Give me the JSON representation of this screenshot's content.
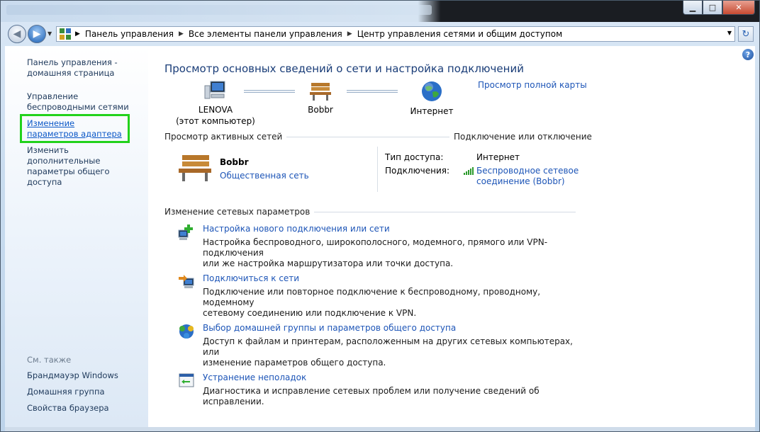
{
  "titlebar": {
    "minimize": "▁",
    "maximize": "□",
    "close": "✕"
  },
  "address": {
    "crumbs": [
      "Панель управления",
      "Все элементы панели управления",
      "Центр управления сетями и общим доступом"
    ]
  },
  "sidebar": {
    "home": "Панель управления - домашняя страница",
    "wireless": "Управление беспроводными сетями",
    "adapter": "Изменение параметров адаптера",
    "sharing": "Изменить дополнительные параметры общего доступа",
    "see_also": "См. также",
    "firewall": "Брандмауэр Windows",
    "homegroup": "Домашняя группа",
    "browser": "Свойства браузера"
  },
  "main": {
    "title": "Просмотр основных сведений о сети и настройка подключений",
    "full_map": "Просмотр полной карты",
    "map": {
      "computer_name": "LENOVA",
      "computer_sub": "(этот компьютер)",
      "network": "Bobbr",
      "internet": "Интернет"
    },
    "active_networks": {
      "title": "Просмотр активных сетей",
      "connect_link": "Подключение или отключение",
      "network_name": "Bobbr",
      "network_type": "Общественная сеть",
      "access_label": "Тип доступа:",
      "access_value": "Интернет",
      "connections_label": "Подключения:",
      "connection_line1": "Беспроводное сетевое",
      "connection_line2": "соединение (Bobbr)"
    },
    "change_settings": {
      "title": "Изменение сетевых параметров",
      "tasks": [
        {
          "link": "Настройка нового подключения или сети",
          "desc1": "Настройка беспроводного, широкополосного, модемного, прямого или VPN-подключения",
          "desc2": "или же настройка маршрутизатора или точки доступа."
        },
        {
          "link": "Подключиться к сети",
          "desc1": "Подключение или повторное подключение к беспроводному, проводному, модемному",
          "desc2": "сетевому соединению или подключение к VPN."
        },
        {
          "link": "Выбор домашней группы и параметров общего доступа",
          "desc1": "Доступ к файлам и принтерам, расположенным на других сетевых компьютерах, или",
          "desc2": "изменение параметров общего доступа."
        },
        {
          "link": "Устранение неполадок",
          "desc1": "Диагностика и исправление сетевых проблем или получение сведений об исправлении.",
          "desc2": ""
        }
      ]
    }
  },
  "colors": {
    "link": "#1d55b7",
    "title": "#1a3d78",
    "highlight_box": "#22d21c"
  }
}
